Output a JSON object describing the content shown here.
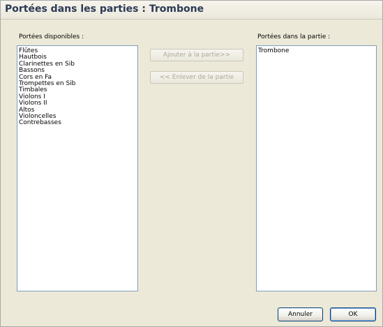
{
  "window": {
    "title": "Portées dans les parties : Trombone"
  },
  "available": {
    "label": "Portées disponibles :",
    "items": [
      "Flûtes",
      "Hautbois",
      "Clarinettes en Sib",
      "Bassons",
      "Cors en Fa",
      "Trompettes en Sib",
      "Timbales",
      "Violons I",
      "Violons II",
      "Altos",
      "Violoncelles",
      "Contrebasses"
    ]
  },
  "in_part": {
    "label": "Portées dans la partie :",
    "items": [
      "Trombone"
    ]
  },
  "actions": {
    "add_label": "Ajouter à la partie>>",
    "remove_label": "<< Enlever de la partie"
  },
  "footer": {
    "cancel_label": "Annuler",
    "ok_label": "OK"
  }
}
